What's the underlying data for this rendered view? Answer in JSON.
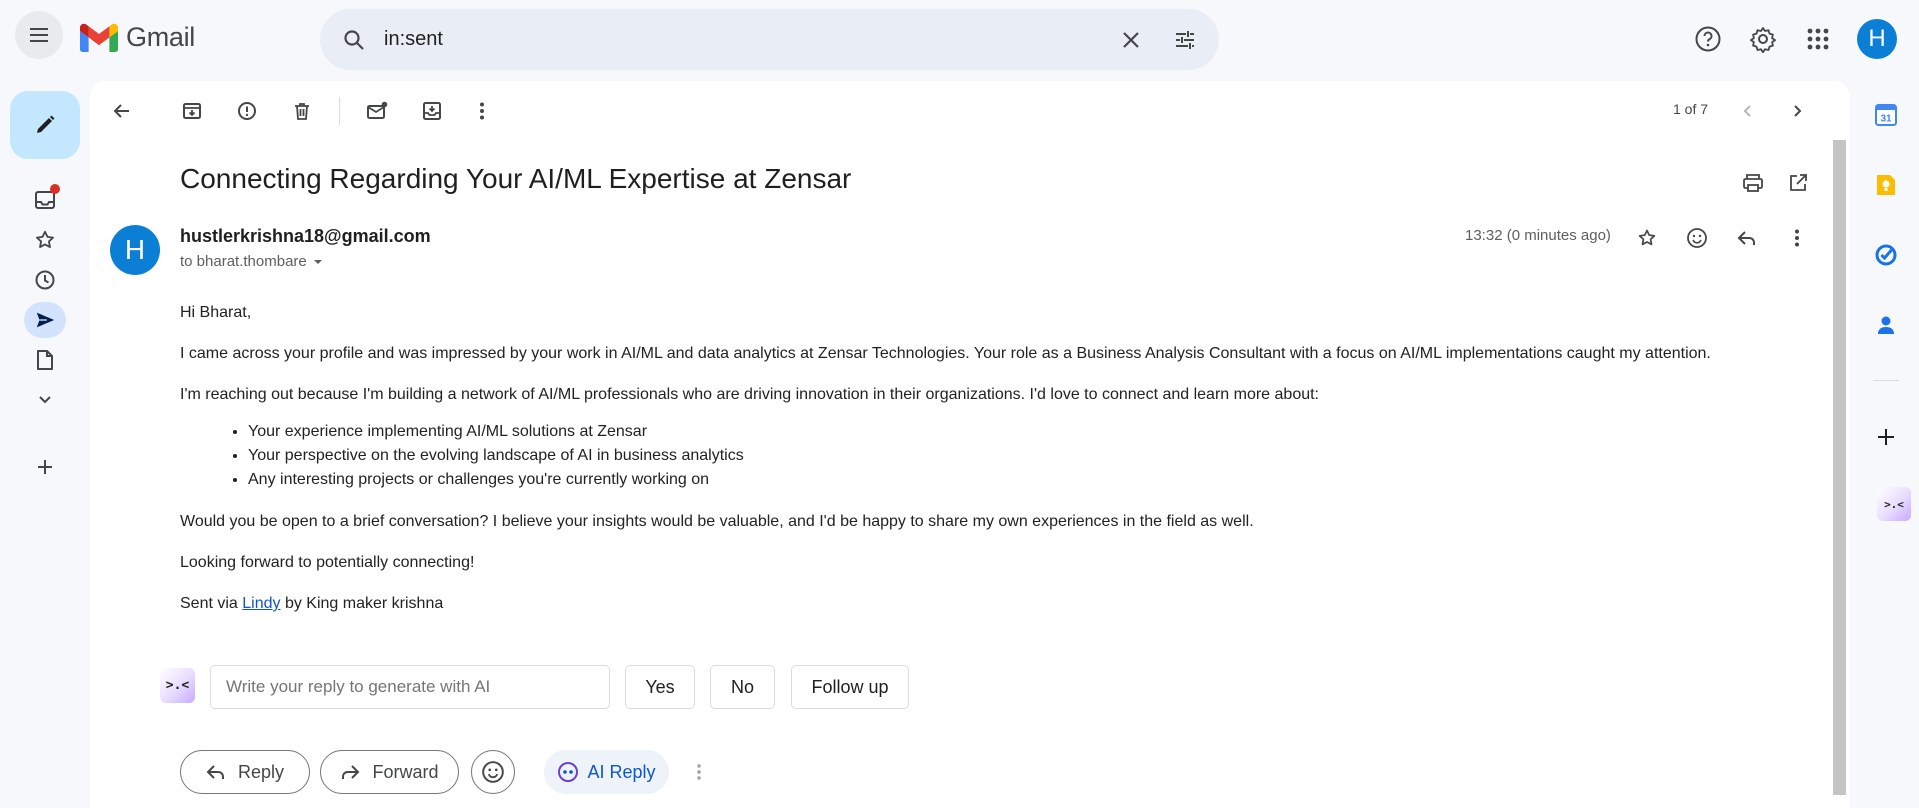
{
  "app": {
    "name": "Gmail"
  },
  "search": {
    "query": "in:sent"
  },
  "header": {
    "avatar_letter": "H"
  },
  "toolbar": {
    "pager": "1 of 7"
  },
  "email": {
    "subject": "Connecting Regarding Your AI/ML Expertise at Zensar",
    "sender_initial": "H",
    "sender": "hustlerkrishna18@gmail.com",
    "to": "to bharat.thombare",
    "time": "13:32 (0 minutes ago)",
    "greeting": "Hi Bharat,",
    "para1": "I came across your profile and was impressed by your work in AI/ML and data analytics at Zensar Technologies. Your role as a Business Analysis Consultant with a focus on AI/ML implementations caught my attention.",
    "para2": "I'm reaching out because I'm building a network of AI/ML professionals who are driving innovation in their organizations. I'd love to connect and learn more about:",
    "bullets": [
      "Your experience implementing AI/ML solutions at Zensar",
      "Your perspective on the evolving landscape of AI in business analytics",
      "Any interesting projects or challenges you're currently working on"
    ],
    "para3": "Would you be open to a brief conversation? I believe your insights would be valuable, and I'd be happy to share my own experiences in the field as well.",
    "para4": "Looking forward to potentially connecting!",
    "sig_prefix": "Sent via ",
    "sig_link": "Lindy",
    "sig_suffix": " by King maker krishna"
  },
  "ai_bar": {
    "logo_glyph": ">.<",
    "placeholder": "Write your reply to generate with AI",
    "quick_replies": [
      "Yes",
      "No",
      "Follow up"
    ]
  },
  "actions": {
    "reply": "Reply",
    "forward": "Forward",
    "ai_reply": "AI Reply"
  },
  "side_panel": {
    "calendar_day": "31",
    "extension_glyph": ">.<"
  },
  "icons": {
    "menu": "menu-icon",
    "search": "search-icon",
    "clear": "close-icon",
    "tune": "tune-icon",
    "help": "help-icon",
    "settings": "gear-icon",
    "apps": "apps-grid-icon",
    "compose": "pencil-icon",
    "inbox": "inbox-icon",
    "starred": "star-icon",
    "snoozed": "clock-icon",
    "sent": "send-icon",
    "drafts": "draft-icon",
    "more": "chevron-down-icon",
    "add_label": "plus-icon",
    "back": "back-arrow-icon",
    "archive": "archive-icon",
    "spam": "report-spam-icon",
    "delete": "trash-icon",
    "mark_unread": "mark-unread-icon",
    "move_to": "move-to-inbox-icon",
    "more_vert": "more-vert-icon",
    "prev": "chevron-left-icon",
    "next": "chevron-right-icon",
    "print": "print-icon",
    "open_new": "open-in-new-icon",
    "star": "star-icon",
    "emoji": "emoji-icon",
    "reply": "reply-icon",
    "forward": "forward-icon",
    "calendar": "calendar-icon",
    "keep": "keep-icon",
    "tasks": "tasks-icon",
    "contacts": "contacts-icon"
  },
  "colors": {
    "background": "#f6f8fc",
    "compose": "#c2e7ff",
    "active_nav": "#d3e3fd",
    "search_bg": "#e9eef6",
    "avatar": "#0b7fd5",
    "link": "#1155cc",
    "ai_reply": "#0b57d0",
    "notify_dot": "#d93025"
  }
}
